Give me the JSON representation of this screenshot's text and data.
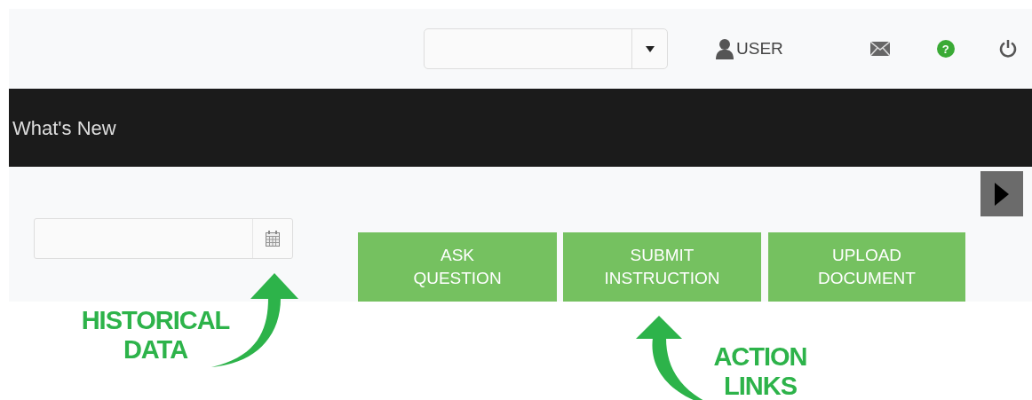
{
  "top_bar": {
    "user": {
      "label": "USER"
    },
    "help": {
      "label": "?"
    }
  },
  "banner": {
    "title": "What's New"
  },
  "action_buttons": [
    {
      "label": "ASK QUESTION"
    },
    {
      "label": "SUBMIT INSTRUCTION"
    },
    {
      "label": "UPLOAD DOCUMENT"
    }
  ],
  "annotations": [
    {
      "kind": "left",
      "text": "HISTORICAL DATA"
    },
    {
      "kind": "right",
      "text": "ACTION LINKS"
    }
  ]
}
